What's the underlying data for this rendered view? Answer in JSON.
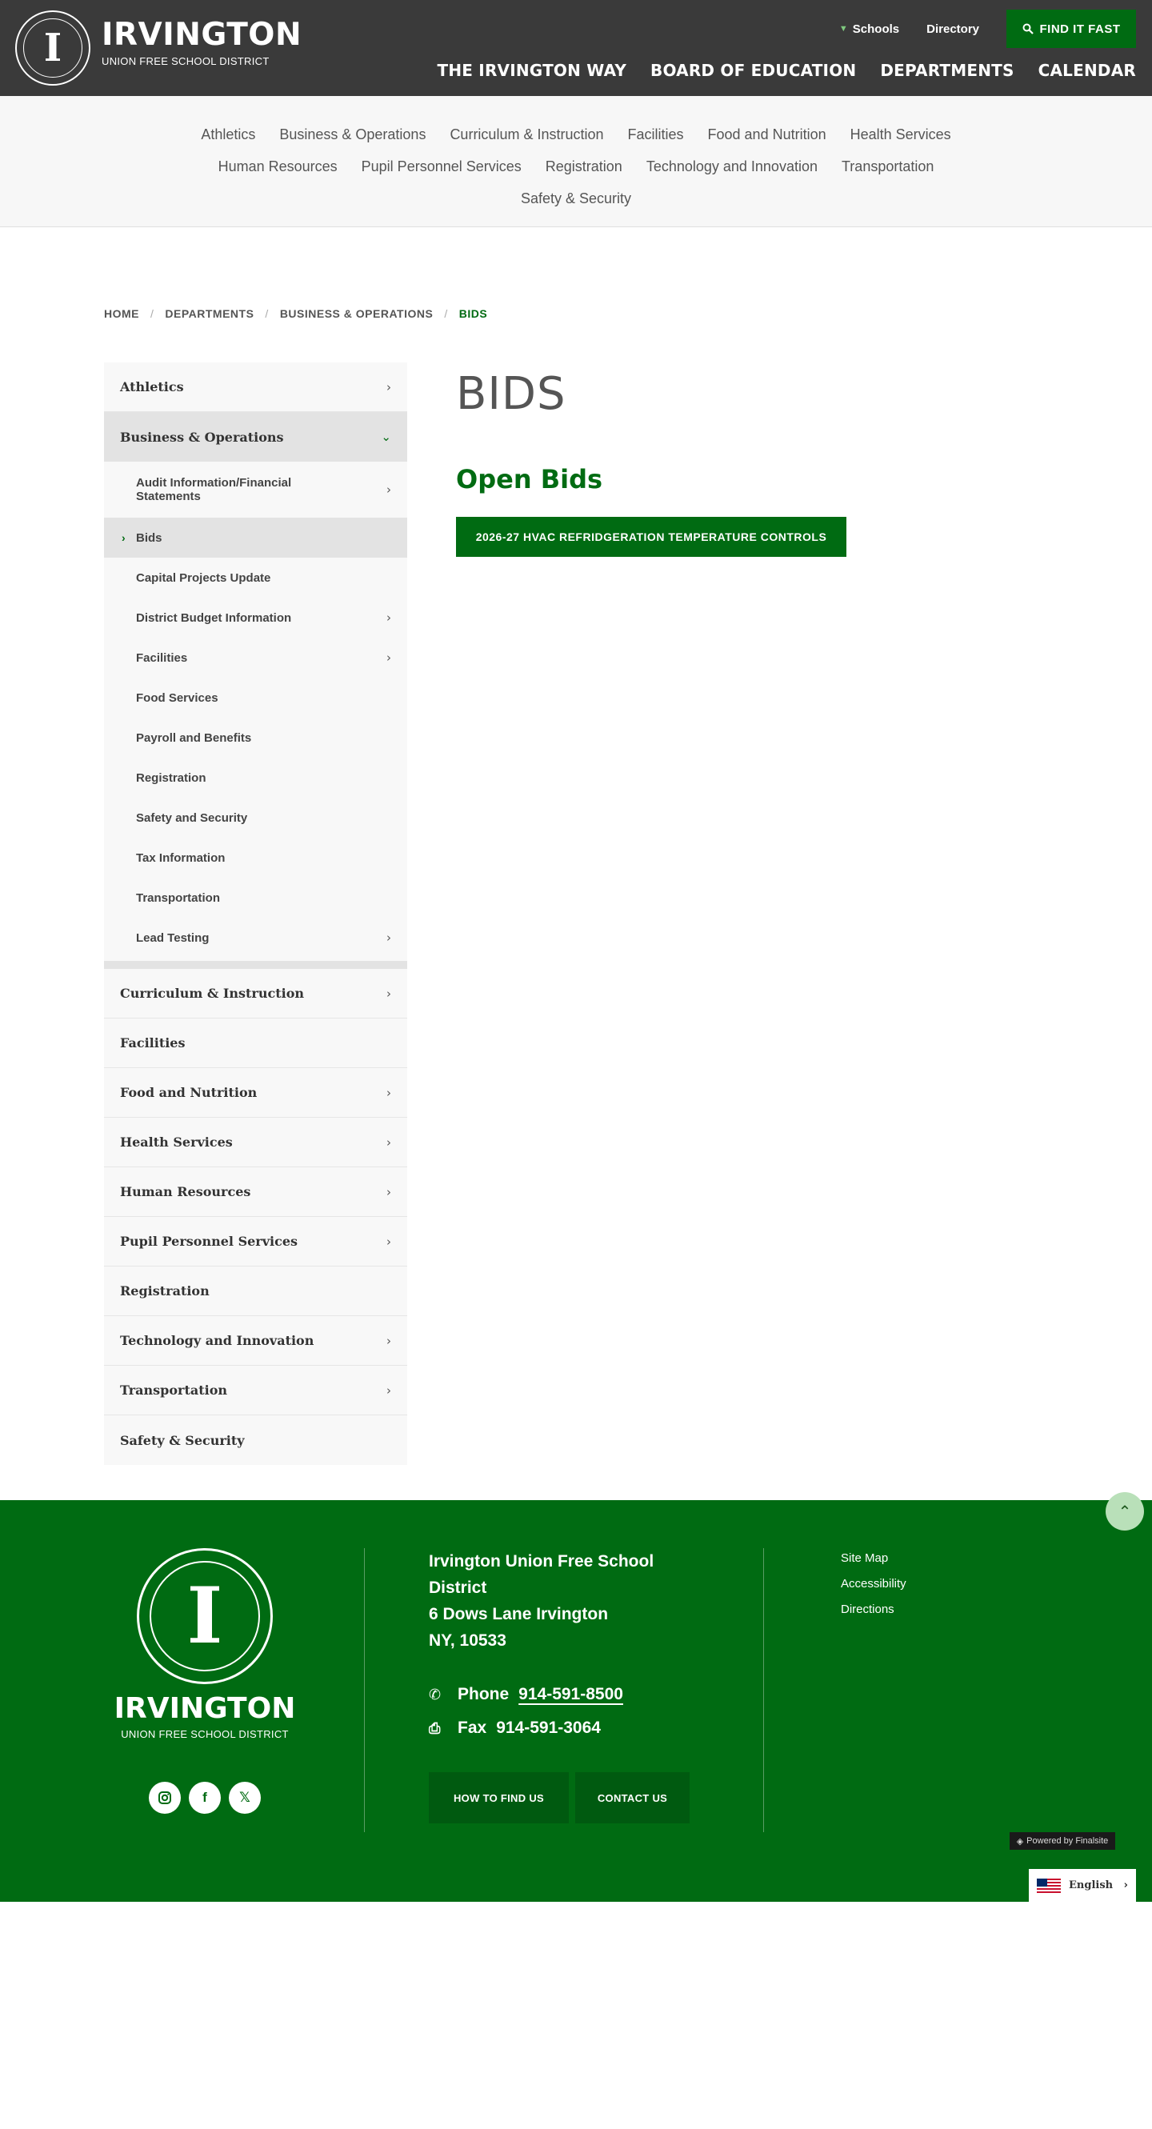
{
  "header": {
    "brand_name": "IRVINGTON",
    "brand_sub": "UNION FREE SCHOOL DISTRICT",
    "logo_letter": "I",
    "util": {
      "schools": "Schools",
      "directory": "Directory",
      "find_it_fast": "FIND IT FAST"
    },
    "main_nav": [
      "THE IRVINGTON WAY",
      "BOARD OF EDUCATION",
      "DEPARTMENTS",
      "CALENDAR"
    ]
  },
  "subnav": {
    "row1": [
      "Athletics",
      "Business & Operations",
      "Curriculum & Instruction",
      "Facilities",
      "Food and Nutrition",
      "Health Services"
    ],
    "row2": [
      "Human Resources",
      "Pupil Personnel Services",
      "Registration",
      "Technology and Innovation",
      "Transportation"
    ],
    "row3": [
      "Safety & Security"
    ]
  },
  "breadcrumb": [
    "HOME",
    "DEPARTMENTS",
    "BUSINESS & OPERATIONS",
    "BIDS"
  ],
  "sidebar": {
    "top": "Athletics",
    "open": "Business & Operations",
    "sub": [
      "Audit Information/Financial Statements",
      "Bids",
      "Capital Projects Update",
      "District Budget Information",
      "Facilities",
      "Food Services",
      "Payroll and Benefits",
      "Registration",
      "Safety and Security",
      "Tax Information",
      "Transportation",
      "Lead Testing"
    ],
    "rest": [
      "Curriculum & Instruction",
      "Facilities",
      "Food and Nutrition",
      "Health Services",
      "Human Resources",
      "Pupil Personnel Services",
      "Registration",
      "Technology and Innovation",
      "Transportation",
      "Safety & Security"
    ]
  },
  "main": {
    "title": "BIDS",
    "section": "Open Bids",
    "bid_button": "2026-27 HVAC REFRIDGERATION TEMPERATURE CONTROLS"
  },
  "footer": {
    "brand_name": "IRVINGTON",
    "brand_sub": "UNION FREE SCHOOL DISTRICT",
    "address": [
      "Irvington Union Free School District",
      "6 Dows Lane Irvington",
      "NY, 10533"
    ],
    "phone_label": "Phone",
    "phone": "914-591-8500",
    "fax_label": "Fax",
    "fax": "914-591-3064",
    "buttons": [
      "HOW TO FIND US",
      "CONTACT US"
    ],
    "links": [
      "Site Map",
      "Accessibility",
      "Directions"
    ],
    "powered": "Powered by Finalsite",
    "language": "English"
  },
  "colors": {
    "brand_green": "#006b12",
    "header_dark": "#3a3a3a",
    "subnav_bg": "#f7f7f7"
  }
}
